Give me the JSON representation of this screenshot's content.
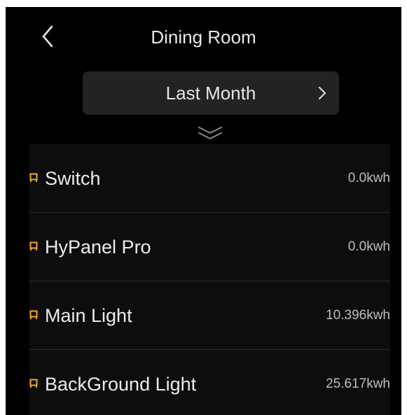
{
  "header": {
    "title": "Dining Room",
    "back_icon": "chevron-left-icon"
  },
  "period": {
    "label": "Last Month",
    "icon": "chevron-right-icon"
  },
  "expand_icon": "double-chevron-down-icon",
  "colors": {
    "background": "#000000",
    "panel": "#232323",
    "list_background": "#0d0d0d",
    "accent": "#f5a623",
    "text": "#ececec",
    "muted_text": "#bdbdbd"
  },
  "devices": [
    {
      "name": "Switch",
      "usage": "0.0kwh",
      "icon": "device-tag-icon"
    },
    {
      "name": "HyPanel Pro",
      "usage": "0.0kwh",
      "icon": "device-tag-icon"
    },
    {
      "name": "Main Light",
      "usage": "10.396kwh",
      "icon": "device-tag-icon"
    },
    {
      "name": "BackGround Light",
      "usage": "25.617kwh",
      "icon": "device-tag-icon"
    }
  ]
}
